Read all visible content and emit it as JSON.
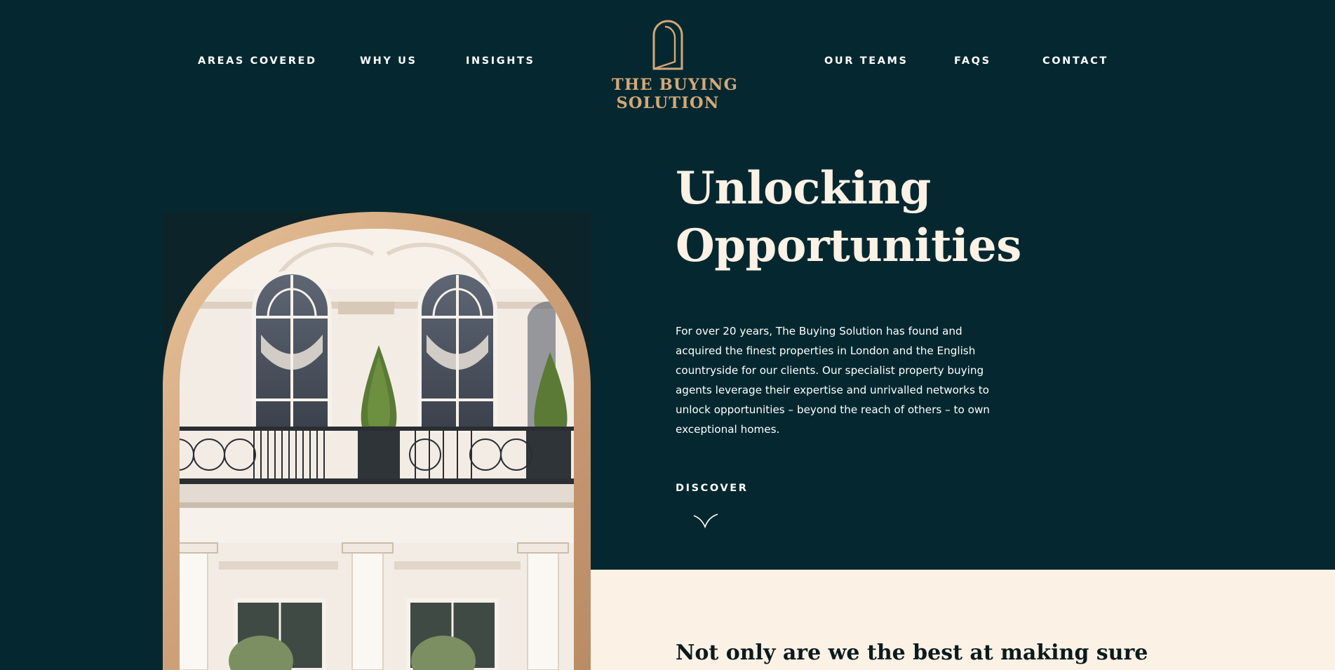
{
  "nav": {
    "left_items": [
      "AREAS COVERED",
      "WHY US",
      "INSIGHTS"
    ],
    "right_items": [
      "OUR TEAMS",
      "FAQS",
      "CONTACT"
    ]
  },
  "logo": {
    "line1": "THE BUYING",
    "line2": "SOLUTION",
    "icon": "arched-door-icon"
  },
  "hero": {
    "title_line1": "Unlocking",
    "title_line2": "Opportunities",
    "body": "For over 20 years, The Buying Solution has found and acquired the finest properties in London and the English countryside for our clients. Our specialist property buying agents leverage their expertise and unrivalled networks to unlock opportunities – beyond the reach of others – to own exceptional homes.",
    "cta_label": "DISCOVER",
    "cta_icon": "chevron-down-icon",
    "image": "arched-window-facade-photo"
  },
  "section": {
    "heading": "Not only are we the best at making sure"
  },
  "colors": {
    "background": "#052830",
    "accent_gold": "#d3a879",
    "cream": "#fbf1e5",
    "title_text": "#fbf1e4"
  }
}
